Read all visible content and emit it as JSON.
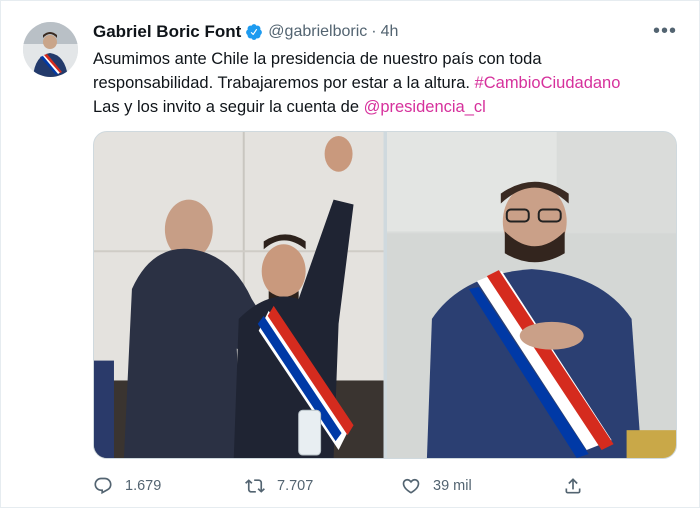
{
  "tweet": {
    "author_name": "Gabriel Boric Font",
    "handle": "@gabrielboric",
    "separator": "·",
    "time": "4h",
    "more_label": "•••",
    "text_lines": {
      "l1": "Asumimos ante Chile la presidencia de nuestro país con toda",
      "l2_main": "responsabilidad. Trabajaremos por estar a la altura. ",
      "l2_hashtag": "#CambioCiudadano",
      "l3_main": "Las y los invito a seguir la cuenta de ",
      "l3_mention": "@presidencia_cl"
    }
  },
  "actions": {
    "reply_count": "1.679",
    "retweet_count": "7.707",
    "like_count": "39 mil"
  },
  "icons": {
    "verified": "verified-badge-icon",
    "reply": "reply-icon",
    "retweet": "retweet-icon",
    "like": "heart-icon",
    "share": "share-icon",
    "more": "more-icon"
  },
  "colors": {
    "link": "#d6319c",
    "verified": "#1d9bf0",
    "muted": "#536471"
  }
}
